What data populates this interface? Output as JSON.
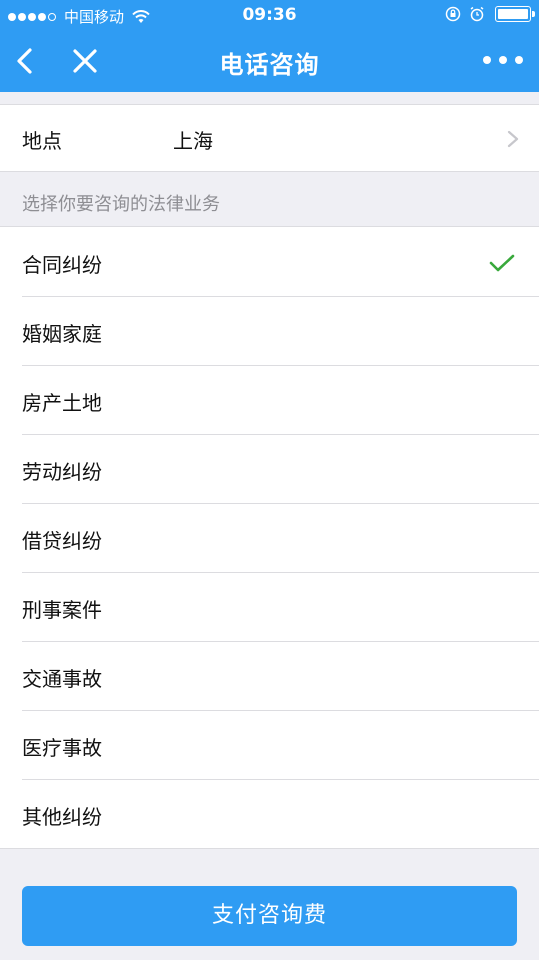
{
  "status_bar": {
    "carrier": "中国移动",
    "time": "09:36",
    "icons": [
      "signal-dots",
      "wifi-icon",
      "rotation-lock-icon",
      "alarm-icon",
      "battery-icon"
    ]
  },
  "nav": {
    "title": "电话咨询",
    "back_icon": "chevron-left-icon",
    "close_icon": "close-icon",
    "more_icon": "more-dots-icon"
  },
  "location": {
    "label": "地点",
    "value": "上海"
  },
  "section_title": "选择你要咨询的法律业务",
  "categories": [
    {
      "label": "合同纠纷",
      "selected": true
    },
    {
      "label": "婚姻家庭",
      "selected": false
    },
    {
      "label": "房产土地",
      "selected": false
    },
    {
      "label": "劳动纠纷",
      "selected": false
    },
    {
      "label": "借贷纠纷",
      "selected": false
    },
    {
      "label": "刑事案件",
      "selected": false
    },
    {
      "label": "交通事故",
      "selected": false
    },
    {
      "label": "医疗事故",
      "selected": false
    },
    {
      "label": "其他纠纷",
      "selected": false
    }
  ],
  "pay_button": "支付咨询费",
  "colors": {
    "primary": "#2f9cf3",
    "check": "#39a93c",
    "background": "#efeff4"
  }
}
